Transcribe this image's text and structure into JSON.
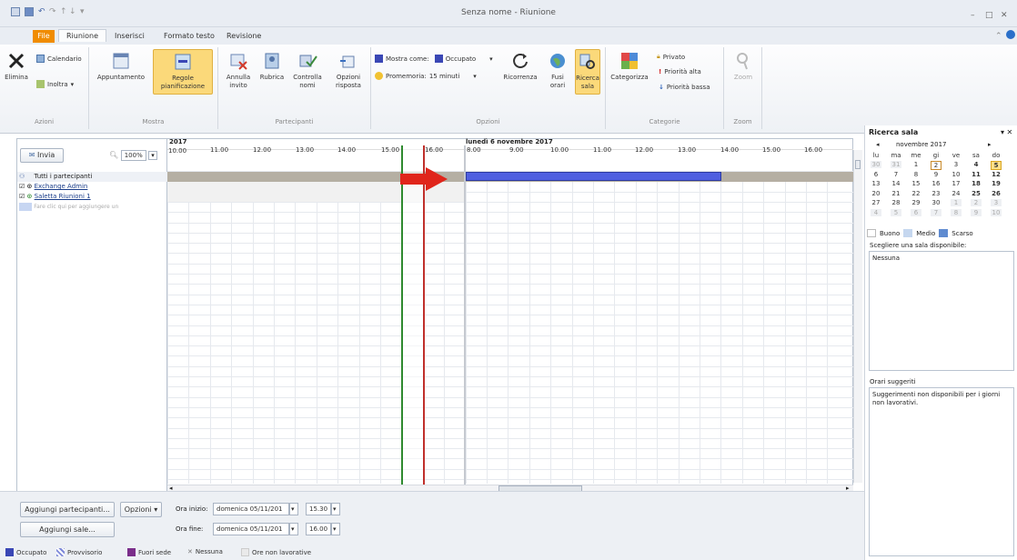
{
  "window": {
    "title": "Senza nome - Riunione",
    "controls": [
      "–",
      "□",
      "✕"
    ]
  },
  "tabs": [
    {
      "label": "File"
    },
    {
      "label": "Riunione"
    },
    {
      "label": "Inserisci"
    },
    {
      "label": "Formato testo"
    },
    {
      "label": "Revisione"
    }
  ],
  "ribbon": {
    "azioni": {
      "label": "Azioni",
      "elimina": "Elimina",
      "calendario": "Calendario",
      "inoltra": "Inoltra"
    },
    "mostra": {
      "label": "Mostra",
      "appuntamento": "Appuntamento",
      "regole": "Regole pianificazione"
    },
    "partecipanti": {
      "label": "Partecipanti",
      "annulla": "Annulla invito",
      "rubrica": "Rubrica",
      "controlla": "Controlla nomi",
      "opzioni": "Opzioni risposta"
    },
    "opzioni": {
      "label": "Opzioni",
      "mostra_come": "Mostra come:",
      "mostra_come_value": "Occupato",
      "promemoria": "Promemoria:",
      "promemoria_value": "15 minuti",
      "ricorrenza": "Ricorrenza",
      "fusi": "Fusi orari",
      "ricerca_sala": "Ricerca sala"
    },
    "categorie": {
      "label": "Categorie",
      "categorizza": "Categorizza",
      "privato": "Privato",
      "priorita_alta": "Priorità alta",
      "priorita_bassa": "Priorità bassa"
    },
    "zoom": {
      "label": "Zoom",
      "zoom": "Zoom"
    }
  },
  "scheduling": {
    "invia": "Invia",
    "zoom": "100%",
    "date_left": "2017",
    "date_right": "lunedì 6 novembre 2017",
    "hours_left": [
      "10.00",
      "11.00",
      "12.00",
      "13.00",
      "14.00",
      "15.00",
      "16.00"
    ],
    "hours_right": [
      "8.00",
      "9.00",
      "10.00",
      "11.00",
      "12.00",
      "13.00",
      "14.00",
      "15.00",
      "16.00"
    ],
    "all_attendees": "Tutti i partecipanti",
    "attendees": [
      "Exchange Admin",
      "Saletta Riunioni 1"
    ],
    "add_placeholder": "Fare clic qui per aggiungere un"
  },
  "bottom": {
    "aggiungi_partecipanti": "Aggiungi partecipanti...",
    "opzioni": "Opzioni",
    "aggiungi_sale": "Aggiungi sale...",
    "ora_inizio_label": "Ora inizio:",
    "ora_inizio_date": "domenica 05/11/201",
    "ora_inizio_time": "15.30",
    "ora_fine_label": "Ora fine:",
    "ora_fine_date": "domenica 05/11/201",
    "ora_fine_time": "16.00",
    "legend": [
      "Occupato",
      "Provvisorio",
      "Fuori sede",
      "Nessuna",
      "Ore non lavorative"
    ]
  },
  "room_finder": {
    "title": "Ricerca sala",
    "month": "novembre 2017",
    "weekdays": [
      "lu",
      "ma",
      "me",
      "gi",
      "ve",
      "sa",
      "do"
    ],
    "weeks": [
      [
        "30",
        "31",
        "1",
        "2",
        "3",
        "4",
        "5"
      ],
      [
        "6",
        "7",
        "8",
        "9",
        "10",
        "11",
        "12"
      ],
      [
        "13",
        "14",
        "15",
        "16",
        "17",
        "18",
        "19"
      ],
      [
        "20",
        "21",
        "22",
        "23",
        "24",
        "25",
        "26"
      ],
      [
        "27",
        "28",
        "29",
        "30",
        "1",
        "2",
        "3"
      ],
      [
        "4",
        "5",
        "6",
        "7",
        "8",
        "9",
        "10"
      ]
    ],
    "legend": [
      "Buono",
      "Medio",
      "Scarso"
    ],
    "choose_room": "Scegliere una sala disponibile:",
    "rooms_value": "Nessuna",
    "suggested_title": "Orari suggeriti",
    "suggested_text": "Suggerimenti non disponibili per i giorni non lavorativi."
  },
  "colors": {
    "busy": "#3a47b5",
    "bar": "#4f5fe0",
    "arrow": "#e0251b",
    "start_line": "#2f8a2f",
    "end_line": "#c0302c"
  }
}
